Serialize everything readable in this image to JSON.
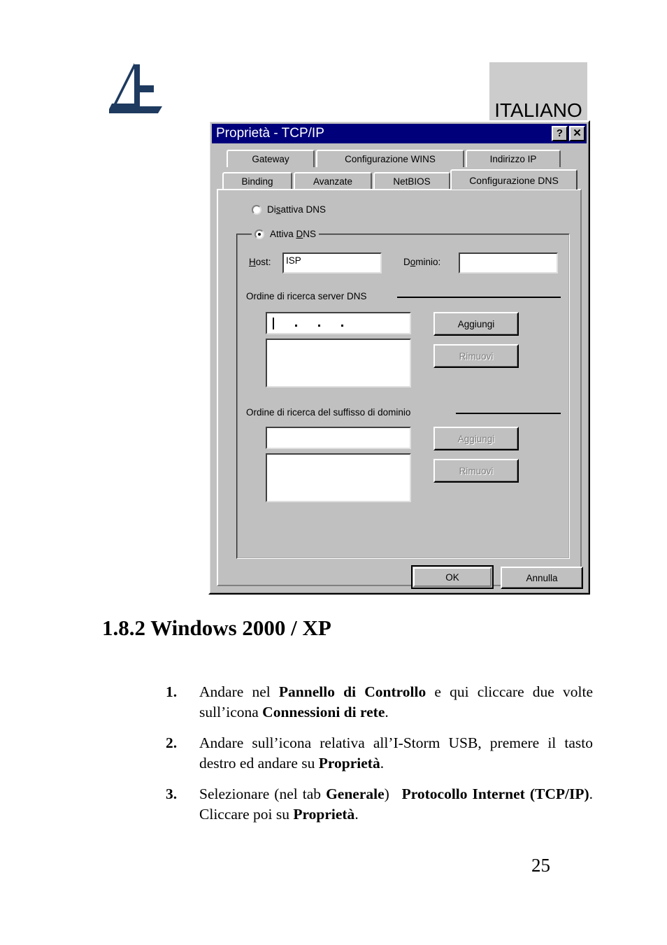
{
  "page": {
    "language_label": "ITALIANO",
    "logo_name": "atlantis-land-sailboat-logo",
    "page_number": "25",
    "heading": "1.8.2 Windows 2000 / XP"
  },
  "dialog": {
    "title": "Proprietà - TCP/IP",
    "help_button": "?",
    "close_button": "✕",
    "tabs_row1": [
      {
        "label": "Gateway",
        "active": false
      },
      {
        "label": "Configurazione WINS",
        "active": false
      },
      {
        "label": "Indirizzo IP",
        "active": false
      }
    ],
    "tabs_row2": [
      {
        "label": "Binding",
        "active": false
      },
      {
        "label": "Avanzate",
        "active": false
      },
      {
        "label": "NetBIOS",
        "active": false
      },
      {
        "label": "Configurazione DNS",
        "active": true
      }
    ],
    "radios": {
      "disable_dns": "Disattiva DNS",
      "enable_dns": "Attiva DNS",
      "selected": "Attiva DNS"
    },
    "host": {
      "label": "Host:",
      "value": "ISP"
    },
    "domain": {
      "label": "Dominio:",
      "value": ""
    },
    "dns_search": {
      "title": "Ordine di ricerca server DNS",
      "entry_value": "",
      "entry_placeholder": ".   .   .",
      "list_items": [],
      "add_button": "Aggiungi",
      "add_enabled": true,
      "remove_button": "Rimuovi",
      "remove_enabled": false
    },
    "suffix_search": {
      "title": "Ordine di ricerca del suffisso di dominio",
      "entry_value": "",
      "list_items": [],
      "add_button": "Aggiungi",
      "add_enabled": false,
      "remove_button": "Rimuovi",
      "remove_enabled": false
    },
    "ok_button": "OK",
    "cancel_button": "Annulla"
  },
  "steps": [
    {
      "number": "1.",
      "parts": [
        {
          "t": "Andare nel ",
          "b": false
        },
        {
          "t": "Pannello di Controllo",
          "b": true
        },
        {
          "t": " e qui cliccare due volte sull’icona ",
          "b": false
        },
        {
          "t": "Connessioni di rete",
          "b": true
        },
        {
          "t": ".",
          "b": false
        }
      ]
    },
    {
      "number": "2.",
      "parts": [
        {
          "t": "Andare sull’icona relativa all’I-Storm USB, premere il tasto destro ed andare su ",
          "b": false
        },
        {
          "t": "Proprietà",
          "b": true
        },
        {
          "t": ".",
          "b": false
        }
      ]
    },
    {
      "number": "3.",
      "parts": [
        {
          "t": "Selezionare (nel tab ",
          "b": false
        },
        {
          "t": "Generale",
          "b": true
        },
        {
          "t": ")  ",
          "b": false
        },
        {
          "t": "Protocollo Internet (TCP/IP)",
          "b": true
        },
        {
          "t": ". Cliccare poi su ",
          "b": false
        },
        {
          "t": "Proprietà",
          "b": true
        },
        {
          "t": ".",
          "b": false
        }
      ]
    }
  ],
  "colors": {
    "titlebar": "#00007b",
    "dialog_face": "#c0c0c0",
    "logo_navy": "#1e3a5f",
    "lang_box": "#cccccc"
  }
}
